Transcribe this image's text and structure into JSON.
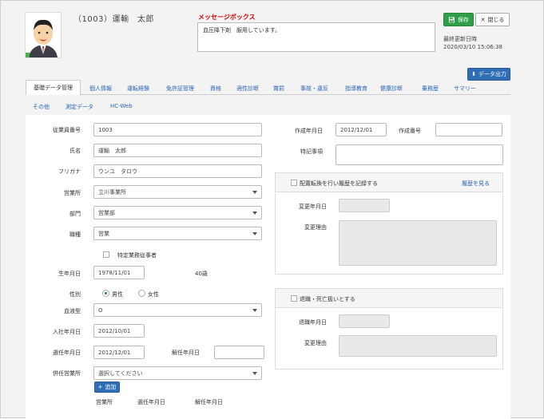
{
  "header": {
    "employee_title": "（1003）運輸　太郎",
    "message_label": "メッセージボックス",
    "message_text": "血圧降下剤　服用しています。",
    "save_label": "保存",
    "close_label": "閉じる",
    "updated_label": "最終更新日時",
    "updated_value": "2020/03/10 15:06:38",
    "export_label": "データ出力"
  },
  "tabs": {
    "row1": [
      "基礎データ管理",
      "個人情報",
      "運転経験",
      "免許証管理",
      "資格",
      "適性診断",
      "賞罰",
      "事故・違反",
      "指導教育",
      "健康診断",
      "乗務歴",
      "サマリー"
    ],
    "row2": [
      "その他",
      "測定データ",
      "HC-Web"
    ]
  },
  "form": {
    "emp_no_label": "従業員番号",
    "emp_no": "1003",
    "name_label": "氏名",
    "name": "運輸　太郎",
    "kana_label": "フリガナ",
    "kana": "ウンユ　タロウ",
    "office_label": "営業所",
    "office": "立川事業所",
    "dept_label": "部門",
    "dept": "営業部",
    "job_label": "職種",
    "job": "営業",
    "specific_label": "特定業務従事者",
    "birth_label": "生年月日",
    "birth": "1978/11/01",
    "age": "40歳",
    "gender_label": "性別",
    "gender_male": "男性",
    "gender_female": "女性",
    "blood_label": "血液型",
    "blood": "O",
    "hire_label": "入社年月日",
    "hire": "2012/10/01",
    "appoint_label": "選任年月日",
    "appoint": "2012/12/01",
    "dismiss_label": "解任年月日",
    "dismiss": "",
    "concurrent_label": "併任営業所",
    "concurrent_placeholder": "選択してください",
    "add_label": "追加",
    "col_office": "営業所",
    "col_appoint": "選任年月日",
    "col_dismiss": "解任年月日"
  },
  "right": {
    "created_label": "作成年月日",
    "created": "2012/12/01",
    "number_label": "作成番号",
    "number": "",
    "notes_label": "特記事項",
    "transfer_check": "配置転換を行い履歴を記録する",
    "history_link": "履歴を見る",
    "change_date_label": "変更年月日",
    "change_reason_label": "変更理由",
    "retire_check": "退職・死亡扱いとする",
    "retire_date_label": "退職年月日",
    "retire_reason_label": "変更理由"
  }
}
